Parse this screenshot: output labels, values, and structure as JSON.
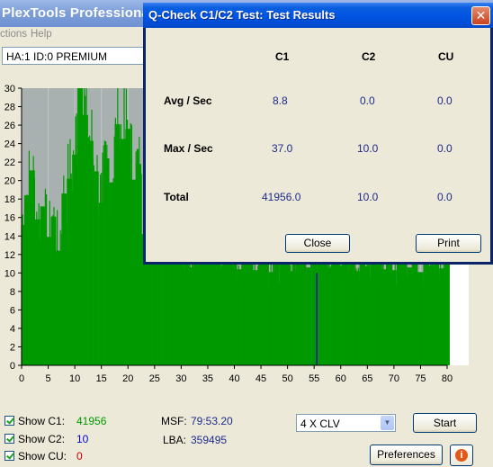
{
  "main_window": {
    "title": "PlexTools Professional XL",
    "menu": [
      "ctions",
      "Help"
    ],
    "device": "HA:1 ID:0  PREMIUM"
  },
  "chart_data": {
    "type": "bar",
    "x_range": [
      0,
      80
    ],
    "y_range": [
      0,
      30
    ],
    "x_ticks": [
      "0",
      "5",
      "10",
      "15",
      "20",
      "25",
      "30",
      "35",
      "40",
      "45",
      "50",
      "55",
      "60",
      "65",
      "70",
      "75",
      "80"
    ],
    "y_ticks": [
      "0",
      "2",
      "4",
      "6",
      "8",
      "10",
      "12",
      "14",
      "16",
      "18",
      "20",
      "22",
      "24",
      "26",
      "28",
      "30"
    ],
    "series": [
      {
        "color": "#009900",
        "values": [
          [
            0,
            15.2
          ],
          [
            1,
            18.4
          ],
          [
            2,
            21.1
          ],
          [
            3,
            15.8
          ],
          [
            4,
            17.2
          ],
          [
            5,
            13.9
          ],
          [
            6,
            16.1
          ],
          [
            7,
            12.4
          ],
          [
            8,
            18.6
          ],
          [
            9,
            20.2
          ],
          [
            10,
            22.8
          ],
          [
            11,
            30
          ],
          [
            12,
            27.1
          ],
          [
            13,
            24.3
          ],
          [
            14,
            21.0
          ],
          [
            15,
            17.6
          ],
          [
            16,
            22.4
          ],
          [
            17,
            19.8
          ],
          [
            18,
            26.1
          ],
          [
            19,
            24.5
          ],
          [
            20,
            25.6
          ],
          [
            21,
            20.1
          ],
          [
            22,
            21.8
          ],
          [
            23,
            14.2
          ],
          [
            24,
            16.6
          ],
          [
            25,
            17.8
          ],
          [
            26,
            13.9
          ],
          [
            27,
            15.4
          ],
          [
            28,
            12.1
          ],
          [
            29,
            14.6
          ],
          [
            30,
            13.2
          ],
          [
            31,
            12.8
          ],
          [
            32,
            10.6
          ],
          [
            33,
            12.3
          ],
          [
            34,
            11.1
          ],
          [
            35,
            14.0
          ],
          [
            36,
            12.5
          ],
          [
            37,
            11.4
          ],
          [
            38,
            10.8
          ],
          [
            39,
            12.9
          ],
          [
            40,
            11.7
          ],
          [
            41,
            10.4
          ],
          [
            42,
            13.1
          ],
          [
            43,
            11.9
          ],
          [
            44,
            10.3
          ],
          [
            45,
            12.4
          ],
          [
            46,
            11.2
          ],
          [
            47,
            10.1
          ],
          [
            48,
            12.2
          ],
          [
            49,
            10.9
          ],
          [
            50,
            11.6
          ],
          [
            51,
            10.2
          ],
          [
            52,
            12.7
          ],
          [
            53,
            11.3
          ],
          [
            54,
            10.6
          ],
          [
            55,
            11.8
          ],
          [
            56,
            10.9
          ],
          [
            57,
            12.1
          ],
          [
            58,
            10.5
          ],
          [
            59,
            11.4
          ],
          [
            60,
            10.8
          ],
          [
            61,
            12.3
          ],
          [
            62,
            11.1
          ],
          [
            63,
            10.2
          ],
          [
            64,
            11.9
          ],
          [
            65,
            10.7
          ],
          [
            66,
            12.6
          ],
          [
            67,
            11.0
          ],
          [
            68,
            10.4
          ],
          [
            69,
            11.7
          ],
          [
            70,
            10.3
          ],
          [
            71,
            12.0
          ],
          [
            72,
            11.2
          ],
          [
            73,
            10.6
          ],
          [
            74,
            11.5
          ],
          [
            75,
            10.1
          ],
          [
            76,
            11.3
          ],
          [
            77,
            10.8
          ],
          [
            78,
            11.9
          ],
          [
            79,
            10.5
          ],
          [
            80,
            11.0
          ]
        ]
      },
      {
        "color": "#0000cc",
        "values": [
          [
            55.5,
            10
          ]
        ]
      }
    ]
  },
  "bottom": {
    "show_c1_label": "Show C1:",
    "show_c1_value": "41956",
    "show_c2_label": "Show C2:",
    "show_c2_value": "10",
    "show_cu_label": "Show CU:",
    "show_cu_value": "0",
    "msf_label": "MSF:",
    "msf_value": "79:53.20",
    "lba_label": "LBA:",
    "lba_value": "359495",
    "speed_select": "4 X CLV",
    "start_label": "Start",
    "preferences_label": "Preferences",
    "colors": {
      "c1": "#009900",
      "c2": "#0000cc",
      "cu": "#cc0000"
    }
  },
  "dialog": {
    "title": "Q-Check C1/C2 Test: Test Results",
    "col_c1": "C1",
    "col_c2": "C2",
    "col_cu": "CU",
    "rows": [
      {
        "label": "Avg / Sec",
        "c1": "8.8",
        "c2": "0.0",
        "cu": "0.0"
      },
      {
        "label": "Max / Sec",
        "c1": "37.0",
        "c2": "10.0",
        "cu": "0.0"
      },
      {
        "label": "Total",
        "c1": "41956.0",
        "c2": "10.0",
        "cu": "0.0"
      }
    ],
    "close_label": "Close",
    "print_label": "Print"
  }
}
